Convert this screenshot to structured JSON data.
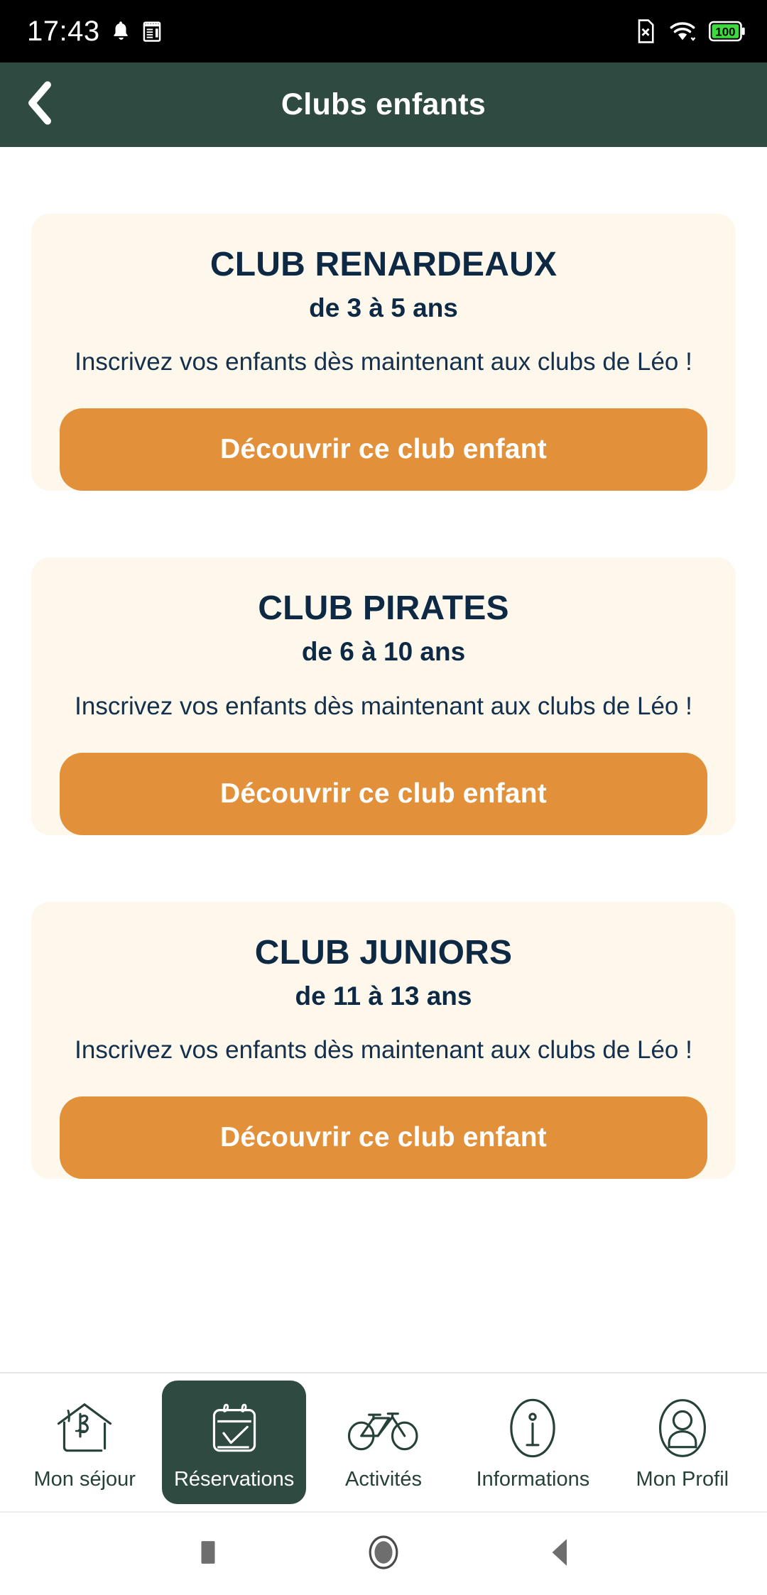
{
  "status_bar": {
    "time": "17:43",
    "left_icons": [
      "bell-icon",
      "notes-icon"
    ],
    "right_icons": [
      "sim-card-x-icon",
      "wifi-icon",
      "battery-icon"
    ],
    "battery_level": "100",
    "background": "#000000"
  },
  "header": {
    "title": "Clubs enfants",
    "back_icon": "chevron-left-icon",
    "background": "#2E4A41"
  },
  "theme": {
    "card_background": "#FDF8EB",
    "accent_orange": "#E2903A",
    "navy_text": "#0E2944",
    "green": "#2E4A41"
  },
  "clubs": [
    {
      "title": "CLUB RENARDEAUX",
      "age": "de 3 à 5 ans",
      "description": "Inscrivez vos enfants dès maintenant aux clubs de Léo !",
      "button_label": "Découvrir ce club enfant"
    },
    {
      "title": "CLUB PIRATES",
      "age": "de 6 à 10 ans",
      "description": "Inscrivez vos enfants dès maintenant aux clubs de Léo !",
      "button_label": "Découvrir ce club enfant"
    },
    {
      "title": "CLUB JUNIORS",
      "age": "de 11 à 13 ans",
      "description": "Inscrivez vos enfants dès maintenant aux clubs de Léo !",
      "button_label": "Découvrir ce club enfant"
    }
  ],
  "tab_bar": {
    "active_index": 1,
    "items": [
      {
        "label": "Mon séjour",
        "icon": "house-b-icon"
      },
      {
        "label": "Réservations",
        "icon": "calendar-check-icon"
      },
      {
        "label": "Activités",
        "icon": "bicycle-icon"
      },
      {
        "label": "Informations",
        "icon": "info-circle-icon"
      },
      {
        "label": "Mon Profil",
        "icon": "person-circle-icon"
      }
    ]
  },
  "android_nav": {
    "recents_icon": "square-icon",
    "home_icon": "circle-icon",
    "back_icon": "triangle-left-icon"
  }
}
